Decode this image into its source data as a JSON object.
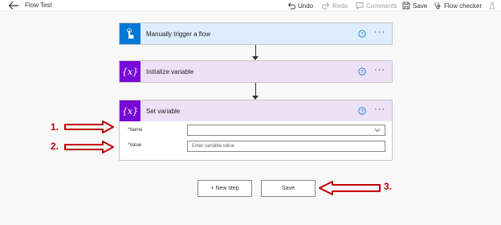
{
  "toolbar": {
    "title": "Flow Test",
    "undo": "Undo",
    "redo": "Redo",
    "comments": "Comments",
    "save": "Save",
    "flow_checker": "Flow checker"
  },
  "cards": {
    "trigger": {
      "title": "Manually trigger a flow"
    },
    "init": {
      "title": "Initialize variable",
      "icon_text": "{x}"
    },
    "set": {
      "title": "Set variable",
      "icon_text": "{x}"
    }
  },
  "set_fields": {
    "name_label": "Name",
    "value_label": "Value",
    "value_placeholder": "Enter variable value",
    "required_mark": "*"
  },
  "buttons": {
    "new_step": "+ New step",
    "save": "Save"
  },
  "annotations": {
    "one": "1.",
    "two": "2.",
    "three": "3.",
    "color": "#c00000"
  },
  "colors": {
    "trigger_accent": "#0078d4",
    "variable_accent": "#770bd6"
  }
}
